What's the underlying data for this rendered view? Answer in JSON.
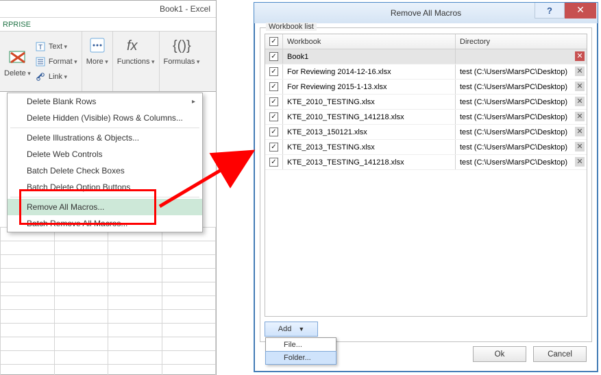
{
  "excel": {
    "title": "Book1 - Excel",
    "tab_label": "RPRISE",
    "ribbon": {
      "delete_label": "Delete",
      "text_label": "Text",
      "format_label": "Format",
      "link_label": "Link",
      "more_label": "More",
      "functions_label": "Functions",
      "formulas_label": "Formulas"
    },
    "menu": {
      "items": [
        {
          "label": "Delete Blank Rows",
          "sub": true
        },
        {
          "label": "Delete Hidden (Visible) Rows & Columns..."
        },
        {
          "label": "Delete Illustrations & Objects..."
        },
        {
          "label": "Delete Web Controls"
        },
        {
          "label": "Batch Delete Check Boxes"
        },
        {
          "label": "Batch Delete Option Buttons"
        },
        {
          "label": "Remove All Macros...",
          "hover": true
        },
        {
          "label": "Batch Remove All Macros..."
        }
      ]
    }
  },
  "dialog": {
    "title": "Remove All Macros",
    "help_glyph": "?",
    "close_glyph": "✕",
    "group_legend": "Workbook list",
    "columns": {
      "workbook": "Workbook",
      "directory": "Directory"
    },
    "rows": [
      {
        "workbook": "Book1",
        "directory": "",
        "selected": true,
        "danger": true
      },
      {
        "workbook": "For Reviewing 2014-12-16.xlsx",
        "directory": "test (C:\\Users\\MarsPC\\Desktop)"
      },
      {
        "workbook": "For Reviewing 2015-1-13.xlsx",
        "directory": "test (C:\\Users\\MarsPC\\Desktop)"
      },
      {
        "workbook": "KTE_2010_TESTING.xlsx",
        "directory": "test (C:\\Users\\MarsPC\\Desktop)"
      },
      {
        "workbook": "KTE_2010_TESTING_141218.xlsx",
        "directory": "test (C:\\Users\\MarsPC\\Desktop)"
      },
      {
        "workbook": "KTE_2013_150121.xlsx",
        "directory": "test (C:\\Users\\MarsPC\\Desktop)"
      },
      {
        "workbook": "KTE_2013_TESTING.xlsx",
        "directory": "test (C:\\Users\\MarsPC\\Desktop)"
      },
      {
        "workbook": "KTE_2013_TESTING_141218.xlsx",
        "directory": "test (C:\\Users\\MarsPC\\Desktop)"
      }
    ],
    "add_label": "Add",
    "add_menu": {
      "file": "File...",
      "folder": "Folder..."
    },
    "ok_label": "Ok",
    "cancel_label": "Cancel"
  }
}
